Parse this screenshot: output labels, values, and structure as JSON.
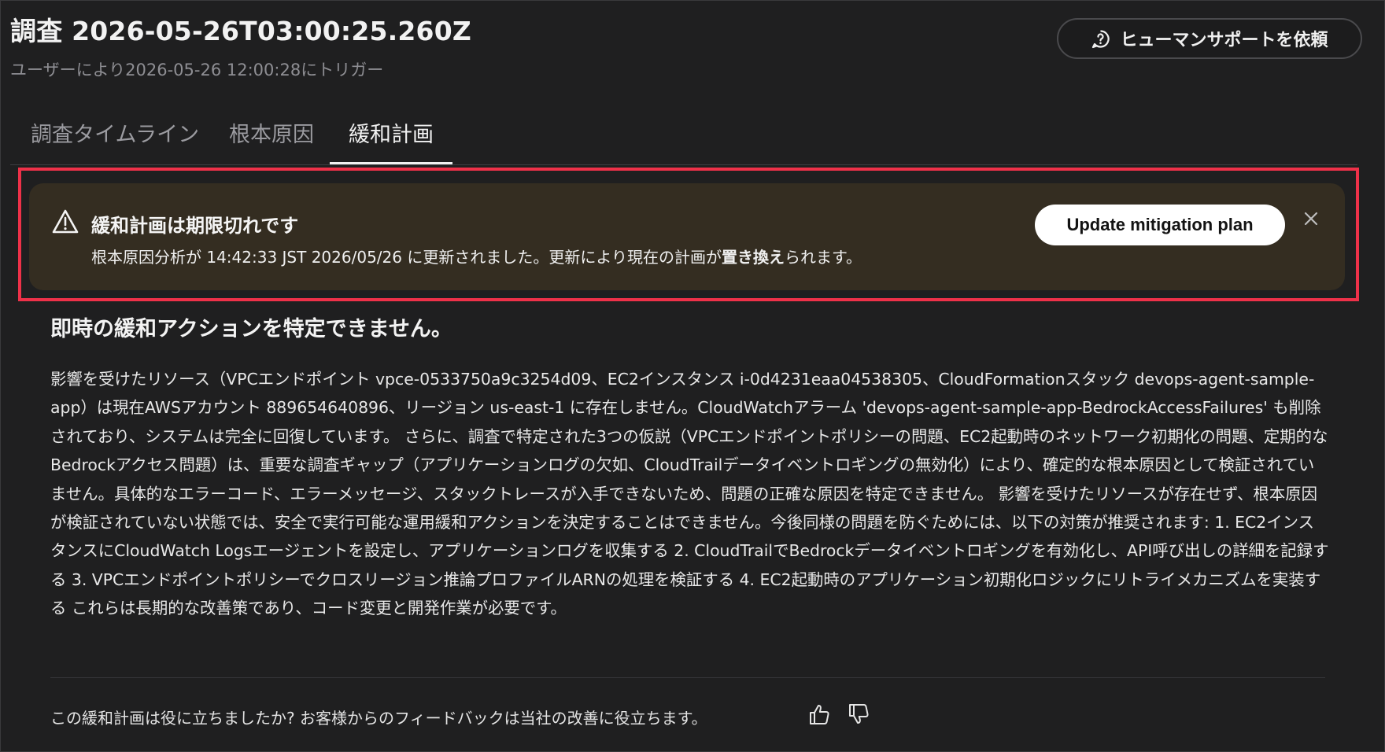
{
  "header": {
    "title": "調査 2026-05-26T03:00:25.260Z",
    "subtitle": "ユーザーにより2026-05-26 12:00:28にトリガー",
    "support_button_label": "ヒューマンサポートを依頼"
  },
  "tabs": [
    {
      "label": "調査タイムライン",
      "active": false
    },
    {
      "label": "根本原因",
      "active": false
    },
    {
      "label": "緩和計画",
      "active": true
    }
  ],
  "warning": {
    "title": "緩和計画は期限切れです",
    "message_prefix": "根本原因分析が 14:42:33 JST 2026/05/26 に更新されました。更新により現在の計画が",
    "message_strong": "置き換え",
    "message_suffix": "られます。",
    "update_button_label": "Update mitigation plan"
  },
  "content": {
    "title": "即時の緩和アクションを特定できません。",
    "body": "影響を受けたリソース（VPCエンドポイント vpce-0533750a9c3254d09、EC2インスタンス i-0d4231eaa04538305、CloudFormationスタック devops-agent-sample-app）は現在AWSアカウント 889654640896、リージョン us-east-1 に存在しません。CloudWatchアラーム 'devops-agent-sample-app-BedrockAccessFailures' も削除されており、システムは完全に回復しています。 さらに、調査で特定された3つの仮説（VPCエンドポイントポリシーの問題、EC2起動時のネットワーク初期化の問題、定期的なBedrockアクセス問題）は、重要な調査ギャップ（アプリケーションログの欠如、CloudTrailデータイベントロギングの無効化）により、確定的な根本原因として検証されていません。具体的なエラーコード、エラーメッセージ、スタックトレースが入手できないため、問題の正確な原因を特定できません。 影響を受けたリソースが存在せず、根本原因が検証されていない状態では、安全で実行可能な運用緩和アクションを決定することはできません。今後同様の問題を防ぐためには、以下の対策が推奨されます: 1. EC2インスタンスにCloudWatch Logsエージェントを設定し、アプリケーションログを収集する 2. CloudTrailでBedrockデータイベントロギングを有効化し、API呼び出しの詳細を記録する 3. VPCエンドポイントポリシーでクロスリージョン推論プロファイルARNの処理を検証する 4. EC2起動時のアプリケーション初期化ロジックにリトライメカニズムを実装する これらは長期的な改善策であり、コード変更と開発作業が必要です。"
  },
  "feedback": {
    "prompt": "この緩和計画は役に立ちましたか? お客様からのフィードバックは当社の改善に役立ちます。"
  },
  "colors": {
    "background": "#1f1f20",
    "banner": "#342d21",
    "highlight_border": "#ee3149",
    "text_muted": "#8e8e93"
  },
  "icons": {
    "support": "help-chat-icon",
    "warning": "warning-triangle-icon",
    "close": "close-icon",
    "thumbs_up": "thumbs-up-icon",
    "thumbs_down": "thumbs-down-icon"
  }
}
